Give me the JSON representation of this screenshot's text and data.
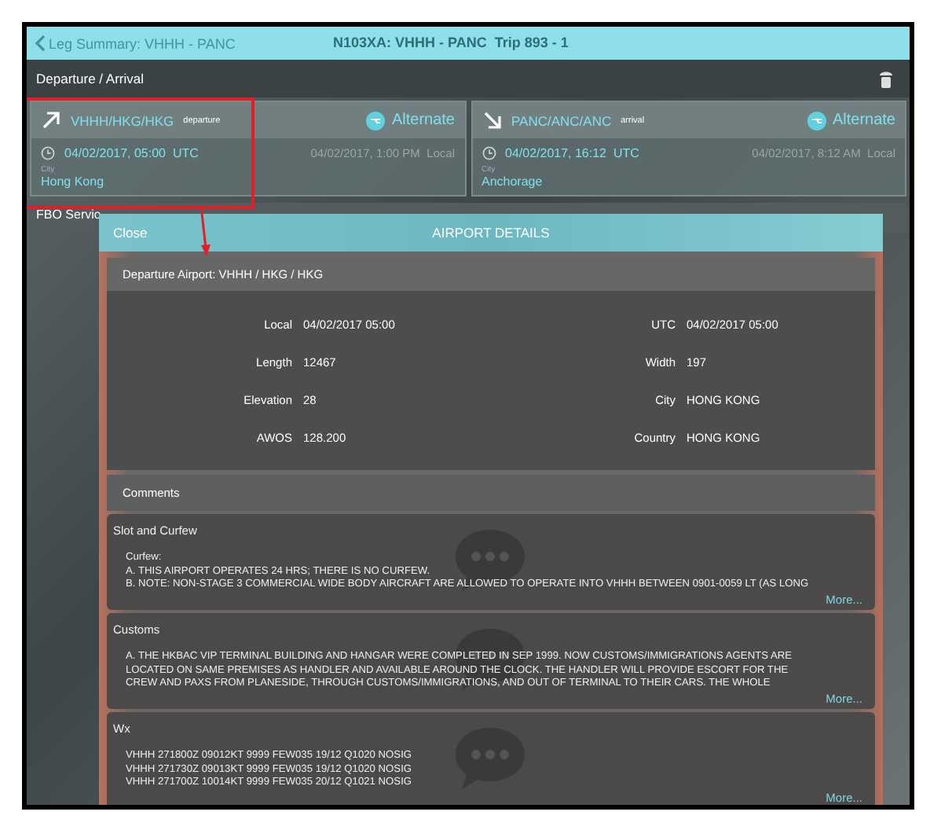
{
  "header": {
    "back_label": "Leg Summary: VHHH - PANC",
    "title": "N103XA: VHHH - PANC  Trip 893 - 1"
  },
  "section": {
    "title": "Departure / Arrival"
  },
  "airports": [
    {
      "kind": "departure",
      "codes": "VHHH/HKG/HKG",
      "tag": "departure",
      "alternate": "Alternate",
      "utc": "04/02/2017, 05:00  UTC",
      "local": "04/02/2017, 1:00 PM  Local",
      "city_label": "City",
      "city": "Hong Kong"
    },
    {
      "kind": "arrival",
      "codes": "PANC/ANC/ANC",
      "tag": "arrival",
      "alternate": "Alternate",
      "utc": "04/02/2017, 16:12  UTC",
      "local": "04/02/2017, 8:12 AM  Local",
      "city_label": "City",
      "city": "Anchorage"
    }
  ],
  "next_section": {
    "title": "FBO Servic"
  },
  "dialog": {
    "close": "Close",
    "title": "AIRPORT DETAILS",
    "subtitle": "Departure Airport: VHHH / HKG / HKG",
    "details": [
      {
        "label": "Local",
        "value": "04/02/2017 05:00"
      },
      {
        "label": "UTC",
        "value": "04/02/2017 05:00"
      },
      {
        "label": "Length",
        "value": "12467"
      },
      {
        "label": "Width",
        "value": "197"
      },
      {
        "label": "Elevation",
        "value": "28"
      },
      {
        "label": "City",
        "value": "HONG KONG"
      },
      {
        "label": "AWOS",
        "value": "128.200"
      },
      {
        "label": "Country",
        "value": "HONG KONG"
      }
    ],
    "comments_title": "Comments",
    "comments": [
      {
        "title": "Slot and Curfew",
        "lines": [
          "Curfew:",
          "A. THIS AIRPORT OPERATES 24 HRS; THERE IS NO CURFEW.",
          "B. NOTE: NON-STAGE 3 COMMERCIAL WIDE BODY AIRCRAFT ARE ALLOWED TO OPERATE INTO VHHH BETWEEN 0901-0059 LT (AS LONG"
        ],
        "more": "More..."
      },
      {
        "title": "Customs",
        "lines": [
          "A. THE HKBAC VIP TERMINAL BUILDING AND HANGAR WERE COMPLETED IN SEP 1999. NOW CUSTOMS/IMMIGRATIONS AGENTS ARE",
          "LOCATED ON SAME PREMISES AS HANDLER AND AVAILABLE AROUND THE CLOCK. THE HANDLER WILL PROVIDE ESCORT FOR THE",
          "CREW AND PAXS FROM PLANESIDE, THROUGH CUSTOMS/IMMIGRATIONS, AND OUT OF TERMINAL TO THEIR CARS. THE WHOLE"
        ],
        "more": "More..."
      },
      {
        "title": "Wx",
        "lines": [
          "VHHH 271800Z 09012KT 9999 FEW035 19/12 Q1020 NOSIG",
          "VHHH 271730Z 09013KT 9999 FEW035 19/12 Q1020 NOSIG",
          "VHHH 271700Z 10014KT 9999 FEW035 20/12 Q1021 NOSIG"
        ],
        "more": "More..."
      }
    ]
  }
}
